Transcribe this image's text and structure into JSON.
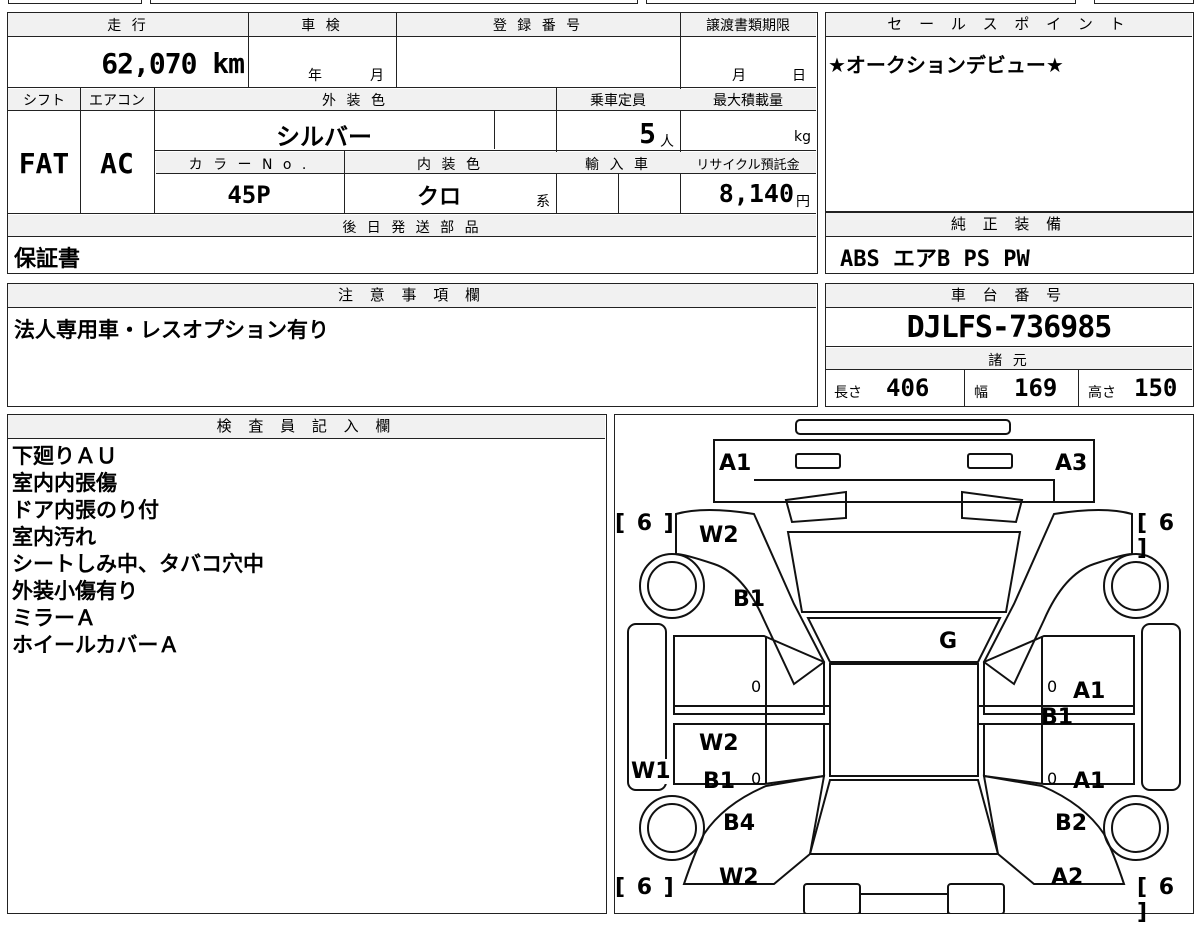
{
  "labels": {
    "mileage": "走 行",
    "inspection": "車 検",
    "registration": "登 録 番 号",
    "transfer_deadline": "譲渡書類期限",
    "sales_point": "セ ー ル ス ポ イ ン ト",
    "shift": "シフト",
    "aircon": "エアコン",
    "exterior_color": "外 装 色",
    "capacity": "乗車定員",
    "max_load": "最大積載量",
    "color_no": "カ ラ ー N o .",
    "interior_color": "内 装 色",
    "import": "輸 入 車",
    "recycle": "リサイクル預託金",
    "later_parts": "後 日 発 送 部 品",
    "standard_equipment": "純 正 装 備",
    "notes": "注 意 事 項 欄",
    "chassis_no": "車 台 番 号",
    "specs": "諸 元",
    "inspector": "検 査 員 記 入 欄",
    "year_unit": "年",
    "month_unit": "月",
    "day_unit": "日",
    "person_unit": "人",
    "kg_unit": "kg",
    "yen_unit": "円",
    "series_unit": "系",
    "length_label": "長さ",
    "width_label": "幅",
    "height_label": "高さ"
  },
  "values": {
    "mileage": "62,070 km",
    "shift": "FAT",
    "aircon": "AC",
    "exterior_color": "シルバー",
    "capacity": "5",
    "color_no": "45P",
    "interior_color": "クロ",
    "recycle": "8,140",
    "later_parts": "保証書",
    "sales_point": "★オークションデビュー★",
    "standard_equipment": "ABS エアB PS PW",
    "notes": "法人専用車・レスオプション有り",
    "chassis_no": "DJLFS-736985",
    "length": "406",
    "width": "169",
    "height": "150"
  },
  "inspector_notes": [
    "下廻りＡＵ",
    "室内内張傷",
    "ドア内張のり付",
    "室内汚れ",
    "シートしみ中、タバコ穴中",
    "外装小傷有り",
    "ミラーＡ",
    "ホイールカバーＡ"
  ],
  "diagram": {
    "tire_marks": [
      "[ 6 ]",
      "[ 6 ]",
      "[ 6 ]",
      "[ 6 ]"
    ],
    "marks": {
      "front_left": "A1",
      "front_right": "A3",
      "left_fender": "W2",
      "left_fender2": "B1",
      "hood": "G",
      "left_rocker": "W1",
      "left_rear_door_a": "W2",
      "left_rear_door_b": "B1",
      "left_quarter": "B4",
      "left_rear": "W2",
      "right_front_door": "A1",
      "right_front_door2": "B1",
      "right_rear_door": "A1",
      "right_quarter": "B2",
      "right_rear": "A2",
      "zero": "0"
    }
  }
}
